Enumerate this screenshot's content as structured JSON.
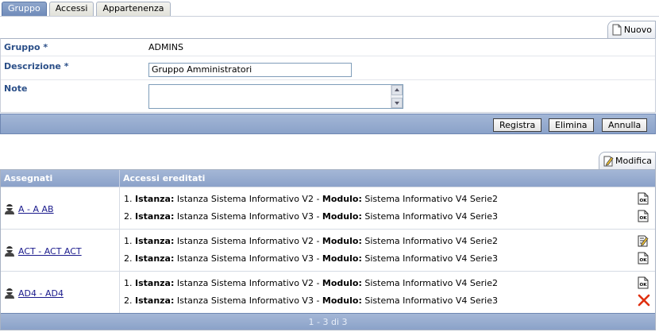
{
  "tabs": [
    {
      "label": "Gruppo",
      "active": true
    },
    {
      "label": "Accessi",
      "active": false
    },
    {
      "label": "Appartenenza",
      "active": false
    }
  ],
  "form": {
    "new_label": "Nuovo",
    "gruppo_label": "Gruppo *",
    "gruppo_value": "ADMINS",
    "descrizione_label": "Descrizione *",
    "descrizione_value": "Gruppo Amministratori",
    "note_label": "Note",
    "note_value": "",
    "buttons": {
      "registra": "Registra",
      "elimina": "Elimina",
      "annulla": "Annulla"
    }
  },
  "table": {
    "edit_label": "Modifica",
    "col_assegnati": "Assegnati",
    "col_accessi": "Accessi ereditati",
    "rows": [
      {
        "user": "A - A AB",
        "accessi": [
          {
            "n": "1.",
            "istanza_label": "Istanza:",
            "istanza": "Istanza Sistema Informativo V2",
            "sep": "-",
            "modulo_label": "Modulo:",
            "modulo": "Sistema Informativo V4 Serie2",
            "icon": "ok-doc-icon"
          },
          {
            "n": "2.",
            "istanza_label": "Istanza:",
            "istanza": "Istanza Sistema Informativo V3",
            "sep": "-",
            "modulo_label": "Modulo:",
            "modulo": "Sistema Informativo V4 Serie3",
            "icon": "ok-doc-icon"
          }
        ]
      },
      {
        "user": "ACT - ACT ACT",
        "accessi": [
          {
            "n": "1.",
            "istanza_label": "Istanza:",
            "istanza": "Istanza Sistema Informativo V2",
            "sep": "-",
            "modulo_label": "Modulo:",
            "modulo": "Sistema Informativo V4 Serie2",
            "icon": "edit-doc-icon"
          },
          {
            "n": "2.",
            "istanza_label": "Istanza:",
            "istanza": "Istanza Sistema Informativo V3",
            "sep": "-",
            "modulo_label": "Modulo:",
            "modulo": "Sistema Informativo V4 Serie3",
            "icon": "ok-doc-icon"
          }
        ]
      },
      {
        "user": "AD4 - AD4",
        "accessi": [
          {
            "n": "1.",
            "istanza_label": "Istanza:",
            "istanza": "Istanza Sistema Informativo V2",
            "sep": "-",
            "modulo_label": "Modulo:",
            "modulo": "Sistema Informativo V4 Serie2",
            "icon": "ok-doc-icon"
          },
          {
            "n": "2.",
            "istanza_label": "Istanza:",
            "istanza": "Istanza Sistema Informativo V3",
            "sep": "-",
            "modulo_label": "Modulo:",
            "modulo": "Sistema Informativo V4 Serie3",
            "icon": "delete-icon"
          }
        ]
      }
    ],
    "pagination": "1 - 3 di 3"
  },
  "colors": {
    "accent": "#8ba2c9",
    "label": "#2b4f88",
    "link": "#1a1a8c",
    "delete": "#e03010"
  }
}
